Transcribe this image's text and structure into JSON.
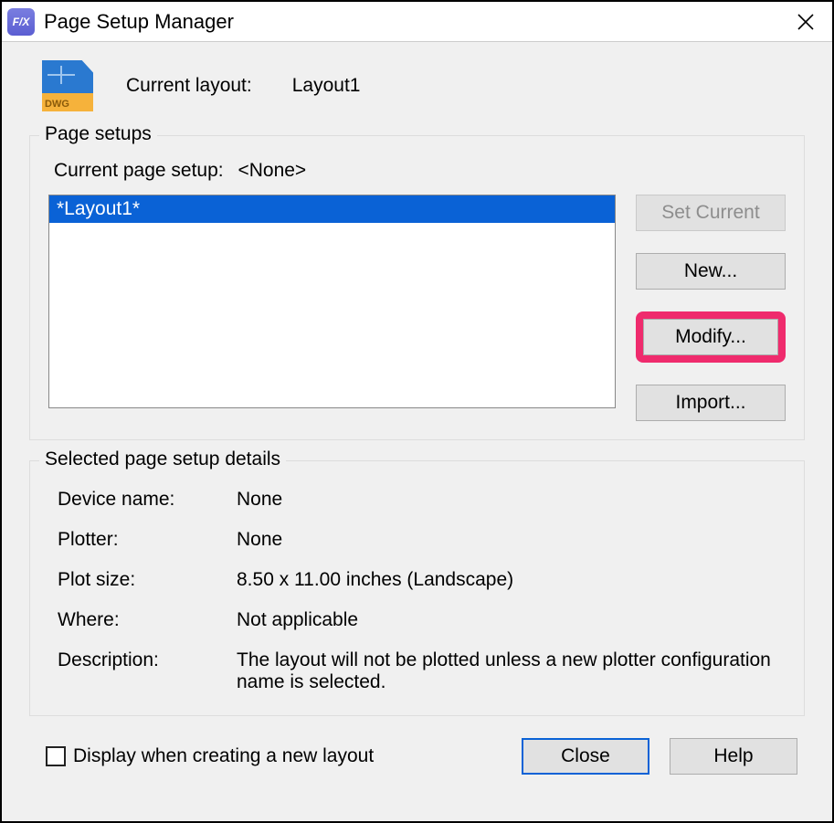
{
  "window": {
    "title": "Page Setup Manager",
    "app_icon_text": "F/X"
  },
  "header": {
    "label": "Current layout:",
    "value": "Layout1",
    "dwg_label": "DWG"
  },
  "page_setups": {
    "legend": "Page setups",
    "current_label": "Current page setup:",
    "current_value": "<None>",
    "items": [
      "*Layout1*"
    ],
    "buttons": {
      "set_current": "Set Current",
      "new": "New...",
      "modify": "Modify...",
      "import": "Import..."
    }
  },
  "details": {
    "legend": "Selected page setup details",
    "rows": {
      "device_name": {
        "label": "Device name:",
        "value": "None"
      },
      "plotter": {
        "label": "Plotter:",
        "value": "None"
      },
      "plot_size": {
        "label": "Plot size:",
        "value": "8.50 x 11.00 inches (Landscape)"
      },
      "where": {
        "label": "Where:",
        "value": "Not applicable"
      },
      "description": {
        "label": "Description:",
        "value": "The layout will not be plotted unless a new plotter configuration name is selected."
      }
    }
  },
  "footer": {
    "checkbox_label": "Display when creating a new layout",
    "close": "Close",
    "help": "Help"
  }
}
